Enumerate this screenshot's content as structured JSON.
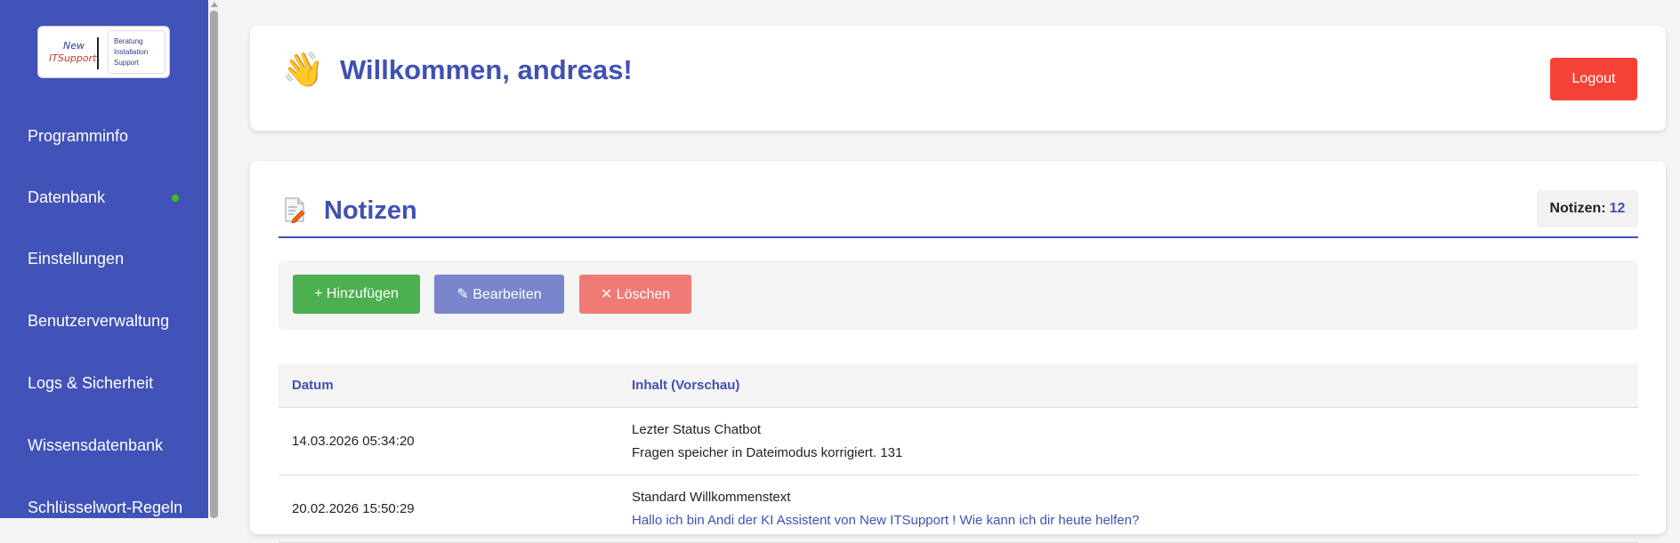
{
  "sidebar": {
    "logo": {
      "left_line1": "New",
      "left_line2": "ITSupport",
      "right_lines": [
        "Beratung",
        "Installation",
        "Support"
      ]
    },
    "items": [
      {
        "label": "Programminfo"
      },
      {
        "label": "Datenbank",
        "status": "connected"
      },
      {
        "label": "Einstellungen"
      },
      {
        "label": "Benutzerverwaltung"
      },
      {
        "label": "Logs & Sicherheit"
      },
      {
        "label": "Wissensdatenbank"
      },
      {
        "label": "Schlüsselwort-Regeln"
      }
    ]
  },
  "header": {
    "wave_icon": "👋",
    "title": "Willkommen, andreas!",
    "logout_label": "Logout"
  },
  "notes": {
    "icon": "📝",
    "title": "Notizen",
    "count_label": "Notizen:",
    "count_value": "12",
    "toolbar": {
      "add_label": "+ Hinzufügen",
      "edit_label": "✎ Bearbeiten",
      "delete_label": "✕ Löschen"
    },
    "table": {
      "headers": [
        "Datum",
        "Inhalt (Vorschau)"
      ],
      "rows": [
        {
          "date": "14.03.2026 05:34:20",
          "line1": "Lezter Status Chatbot",
          "line2": "Fragen speicher in Dateimodus korrigiert. 131"
        },
        {
          "date": "20.02.2026 15:50:29",
          "line1": "Standard Willkommenstext",
          "line2": "Hallo ich bin Andi der KI Assistent von New ITSupport ! Wie kann ich dir heute helfen?"
        }
      ]
    }
  },
  "colors": {
    "sidebar_bg": "#4152b8",
    "accent": "#3f51b5",
    "logout": "#f44336",
    "add": "#4caf50",
    "edit": "#7986cb",
    "delete": "#f07b76",
    "status_online": "#4caf50"
  }
}
